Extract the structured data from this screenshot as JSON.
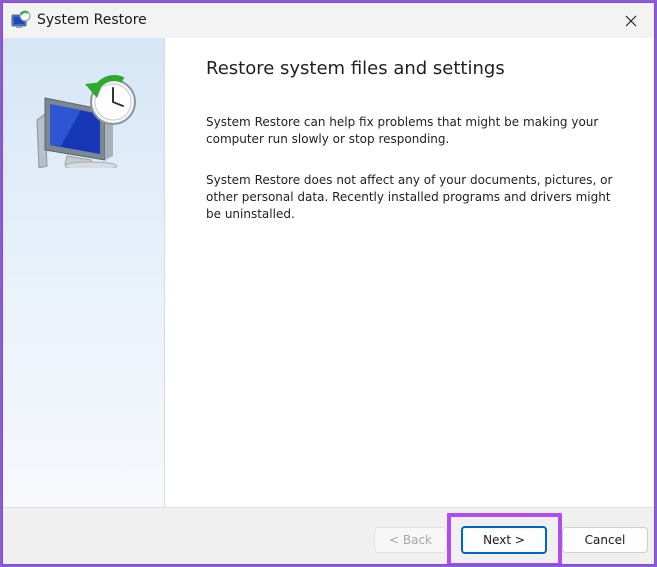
{
  "window": {
    "title": "System Restore"
  },
  "content": {
    "heading": "Restore system files and settings",
    "paragraph1": "System Restore can help fix problems that might be making your computer run slowly or stop responding.",
    "paragraph2": "System Restore does not affect any of your documents, pictures, or other personal data. Recently installed programs and drivers might be uninstalled."
  },
  "footer": {
    "back_label": "< Back",
    "next_label": "Next >",
    "cancel_label": "Cancel"
  },
  "colors": {
    "highlight": "#b34cf0",
    "focus_border": "#0067c0",
    "outer_background": "#8e5bd6"
  },
  "icons": {
    "app": "system-restore-icon",
    "close": "close-icon",
    "hero": "system-restore-monitor-clock-icon"
  }
}
